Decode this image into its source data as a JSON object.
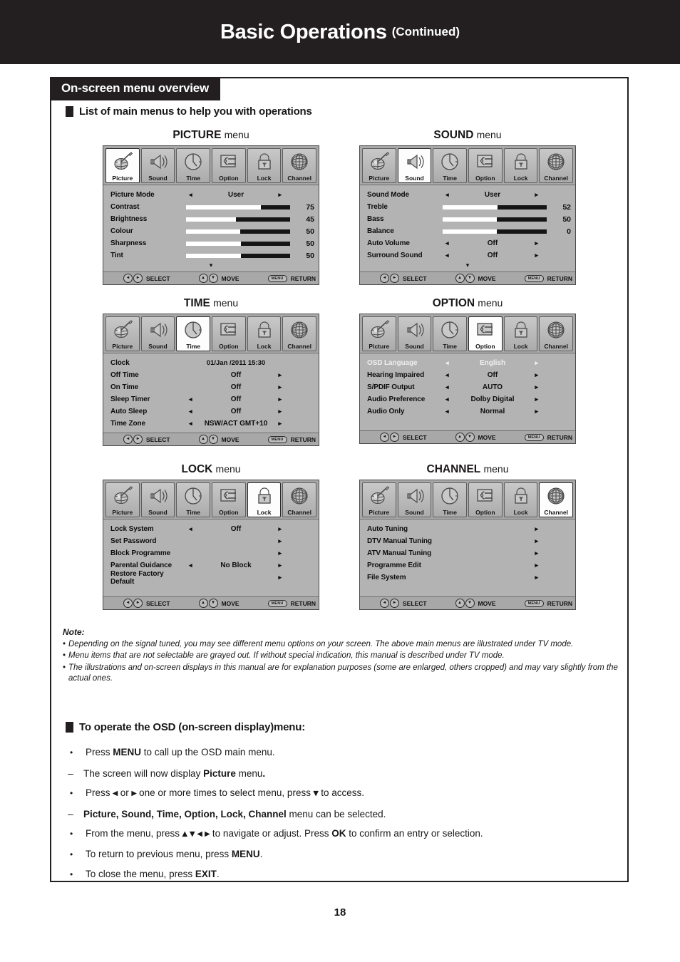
{
  "header": {
    "title": "Basic Operations",
    "continued": "(Continued)"
  },
  "section": {
    "tab_label": "On-screen menu overview",
    "subhead": "List of main menus to help you with operations"
  },
  "icon_tabs": [
    "Picture",
    "Sound",
    "Time",
    "Option",
    "Lock",
    "Channel"
  ],
  "footer_legend": {
    "select": "SELECT",
    "move": "MOVE",
    "return": "RETURN",
    "menu_key": "MENU"
  },
  "menus": [
    {
      "title_big": "PICTURE",
      "title_small": "menu",
      "active": 0,
      "scroll_more": true,
      "rows": [
        {
          "label": "Picture Mode",
          "type": "option",
          "value": "User",
          "left_arrow": true,
          "right_arrow": true
        },
        {
          "label": "Contrast",
          "type": "slider",
          "value": "75",
          "fill": 72
        },
        {
          "label": "Brightness",
          "type": "slider",
          "value": "45",
          "fill": 48
        },
        {
          "label": "Colour",
          "type": "slider",
          "value": "50",
          "fill": 52
        },
        {
          "label": "Sharpness",
          "type": "slider",
          "value": "50",
          "fill": 53
        },
        {
          "label": "Tint",
          "type": "slider",
          "value": "50",
          "fill": 53
        }
      ]
    },
    {
      "title_big": "SOUND",
      "title_small": "menu",
      "active": 1,
      "scroll_more": true,
      "rows": [
        {
          "label": "Sound Mode",
          "type": "option",
          "value": "User",
          "left_arrow": true,
          "right_arrow": true
        },
        {
          "label": "Treble",
          "type": "slider",
          "value": "52",
          "fill": 53
        },
        {
          "label": "Bass",
          "type": "slider",
          "value": "50",
          "fill": 52
        },
        {
          "label": "Balance",
          "type": "slider",
          "value": "0",
          "fill": 52
        },
        {
          "label": "Auto Volume",
          "type": "option",
          "value": "Off",
          "left_arrow": true,
          "right_arrow": true
        },
        {
          "label": "Surround Sound",
          "type": "option",
          "value": "Off",
          "left_arrow": true,
          "right_arrow": true
        }
      ]
    },
    {
      "title_big": "TIME",
      "title_small": "menu",
      "active": 2,
      "scroll_more": false,
      "rows": [
        {
          "label": "Clock",
          "type": "clock",
          "value": "01/Jan  /2011 15:30",
          "left_arrow": false,
          "right_arrow": false
        },
        {
          "label": "Off Time",
          "type": "option",
          "value": "Off",
          "left_arrow": false,
          "right_arrow": true
        },
        {
          "label": "On Time",
          "type": "option",
          "value": "Off",
          "left_arrow": false,
          "right_arrow": true
        },
        {
          "label": "Sleep Timer",
          "type": "option",
          "value": "Off",
          "left_arrow": true,
          "right_arrow": true
        },
        {
          "label": "Auto Sleep",
          "type": "option",
          "value": "Off",
          "left_arrow": true,
          "right_arrow": true
        },
        {
          "label": "Time Zone",
          "type": "option",
          "value": "NSW/ACT GMT+10",
          "left_arrow": true,
          "right_arrow": true
        }
      ]
    },
    {
      "title_big": "OPTION",
      "title_small": "menu",
      "active": 3,
      "scroll_more": false,
      "rows": [
        {
          "label": "OSD Language",
          "type": "option",
          "value": "English",
          "left_arrow": true,
          "right_arrow": true,
          "dim": true
        },
        {
          "label": "Hearing Impaired",
          "type": "option",
          "value": "Off",
          "left_arrow": true,
          "right_arrow": true
        },
        {
          "label": "S/PDIF Output",
          "type": "option",
          "value": "AUTO",
          "left_arrow": true,
          "right_arrow": true
        },
        {
          "label": "Audio Preference",
          "type": "option",
          "value": "Dolby Digital",
          "left_arrow": true,
          "right_arrow": true
        },
        {
          "label": "Audio Only",
          "type": "option",
          "value": "Normal",
          "left_arrow": true,
          "right_arrow": true
        }
      ]
    },
    {
      "title_big": "LOCK",
      "title_small": "menu",
      "active": 4,
      "scroll_more": false,
      "rows": [
        {
          "label": "Lock System",
          "type": "option",
          "value": "Off",
          "left_arrow": true,
          "right_arrow": true
        },
        {
          "label": "Set Password",
          "type": "submenu",
          "value": "",
          "right_arrow": true
        },
        {
          "label": "Block Programme",
          "type": "submenu",
          "value": "",
          "right_arrow": true
        },
        {
          "label": "Parental Guidance",
          "type": "option",
          "value": "No Block",
          "left_arrow": true,
          "right_arrow": true
        },
        {
          "label": "Restore Factory Default",
          "type": "submenu",
          "value": "",
          "right_arrow": true
        }
      ]
    },
    {
      "title_big": "CHANNEL",
      "title_small": "menu",
      "active": 5,
      "scroll_more": false,
      "rows": [
        {
          "label": "Auto Tuning",
          "type": "submenu",
          "value": "",
          "right_arrow": true
        },
        {
          "label": "DTV Manual Tuning",
          "type": "submenu",
          "value": "",
          "right_arrow": true
        },
        {
          "label": "ATV Manual Tuning",
          "type": "submenu",
          "value": "",
          "right_arrow": true
        },
        {
          "label": "Programme Edit",
          "type": "submenu",
          "value": "",
          "right_arrow": true
        },
        {
          "label": "File System",
          "type": "submenu",
          "value": "",
          "right_arrow": true
        }
      ]
    }
  ],
  "note": {
    "heading": "Note:",
    "bullet": "•",
    "items": [
      "Depending on the signal tuned, you may see different menu options on your screen. The above main menus are illustrated under TV mode.",
      "Menu items that are not selectable are grayed out. If without special indication, this manual is described under TV mode.",
      "The illustrations and on-screen displays in this manual are for explanation purposes (some are enlarged, others cropped) and may vary slightly from the actual ones."
    ]
  },
  "operate": {
    "heading": "To operate the OSD (on-screen display)menu:",
    "items": [
      {
        "mark": "•",
        "dash": false,
        "html": "Press <b>MENU</b> to call up the OSD main menu."
      },
      {
        "mark": "–",
        "dash": true,
        "html": "The screen will now display <b>Picture</b> menu<b>.</b>"
      },
      {
        "mark": "•",
        "dash": false,
        "html": "Press <b>◂</b> or <b>▸</b> one or more times to select menu, press <b>▾</b> to access."
      },
      {
        "mark": "–",
        "dash": true,
        "html": "<b>Picture, Sound, Time, Option, Lock, Channel</b> menu can be selected."
      },
      {
        "mark": "•",
        "dash": false,
        "html": "From the menu, press <b>▴ ▾ ◂ ▸</b> to navigate or adjust. Press <b>OK</b> to confirm an entry or selection."
      },
      {
        "mark": "•",
        "dash": false,
        "html": "To return to previous menu, press <b>MENU</b>."
      },
      {
        "mark": "•",
        "dash": false,
        "html": "To close the menu, press <b>EXIT</b>."
      }
    ]
  },
  "page_number": "18",
  "colors": {
    "ink": "#231f20",
    "osd_body": "#b3b3b3",
    "osd_chrome": "#a8a8a8",
    "bar_track": "#151515",
    "bar_fill": "#ffffff"
  }
}
